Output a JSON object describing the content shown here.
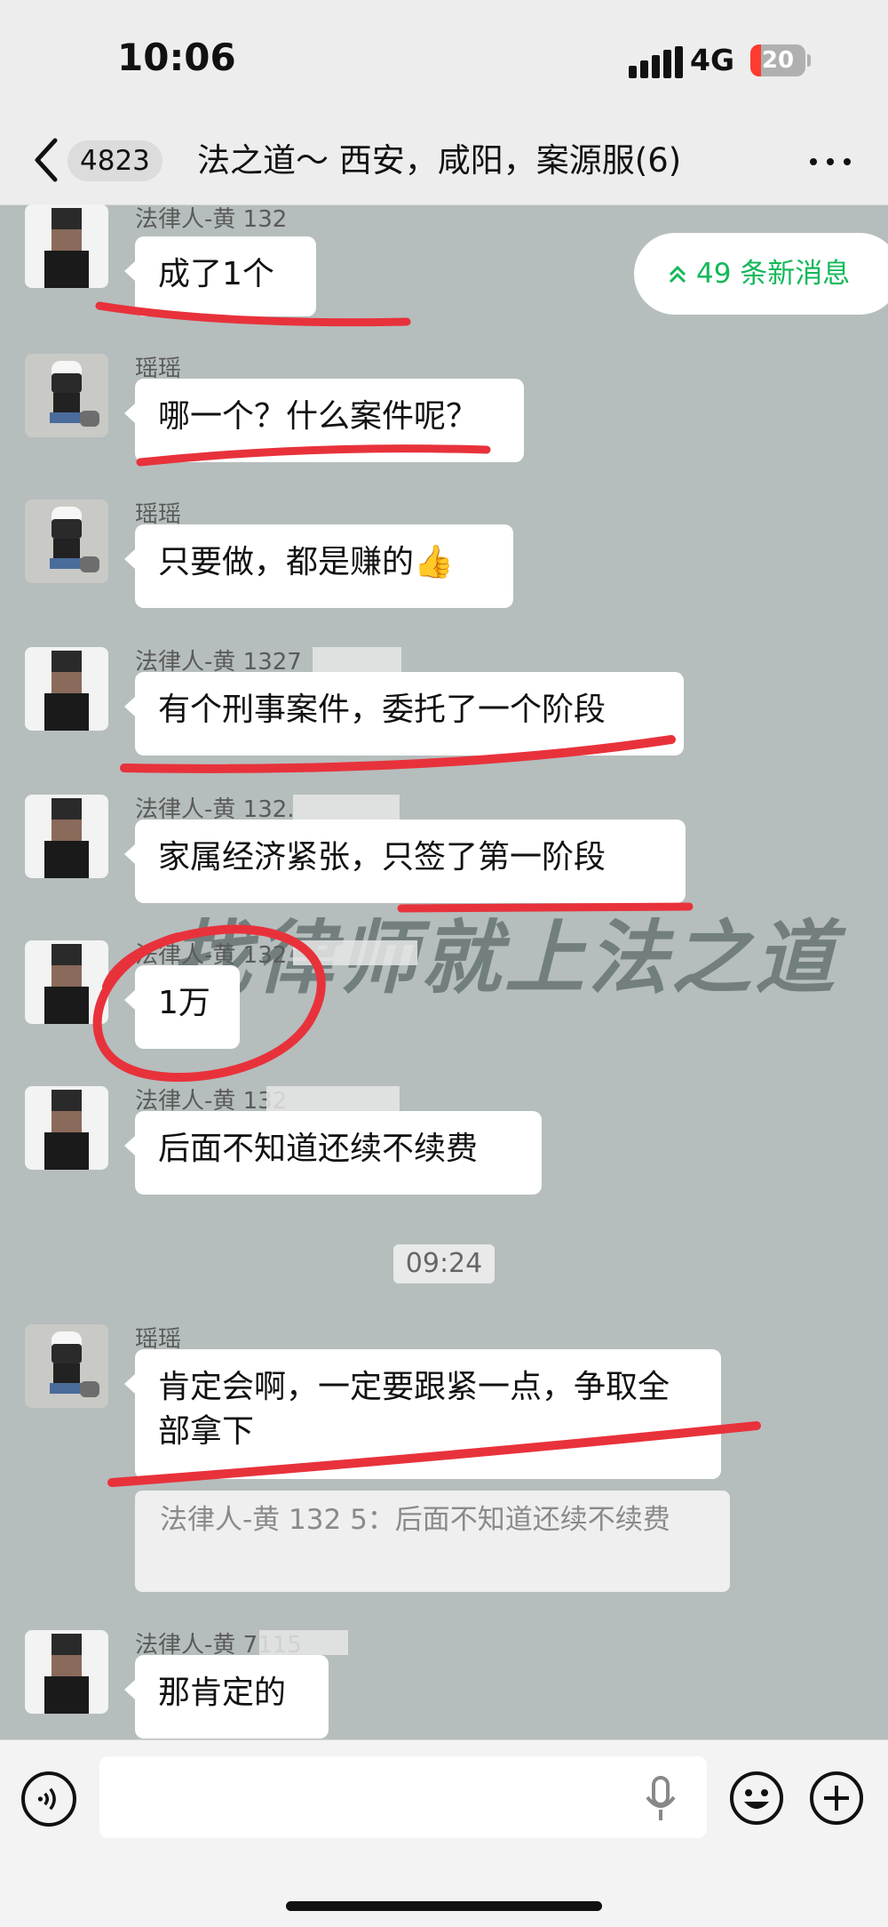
{
  "status_bar": {
    "time": "10:06",
    "network": "4G",
    "battery": "20",
    "battery_level": 0.2
  },
  "header": {
    "unread_count": "4823",
    "title": "法之道～    西安，咸阳，案源服",
    "member_count": "(6)"
  },
  "new_messages": {
    "label": "49 条新消息"
  },
  "messages": [
    {
      "sender": "法律人-黄 132",
      "text": "成了1个"
    },
    {
      "sender": "瑶瑶",
      "text": "哪一个？什么案件呢？"
    },
    {
      "sender": "瑶瑶",
      "text": "只要做，都是赚的👍"
    },
    {
      "sender": "法律人-黄 1327",
      "text": "有个刑事案件，委托了一个阶段"
    },
    {
      "sender": "法律人-黄 132.",
      "text": "家属经济紧张，只签了第一阶段"
    },
    {
      "sender": "法律人-黄 132",
      "text": "1万"
    },
    {
      "sender": "法律人-黄 132",
      "text": "后面不知道还续不续费"
    },
    {
      "sender": "瑶瑶",
      "text": "肯定会啊，一定要跟紧一点，争取全部拿下"
    },
    {
      "sender": "法律人-黄 7115",
      "text": "那肯定的"
    }
  ],
  "timestamp": "09:24",
  "quote": {
    "text": "法律人-黄 132      5：后面不知道还续不续费"
  },
  "watermark": "找律师就上法之道",
  "input": {
    "placeholder": ""
  },
  "colors": {
    "accent_green": "#13b85a",
    "annotation_red": "#e8323b",
    "chat_bg": "#b6bdbd"
  }
}
